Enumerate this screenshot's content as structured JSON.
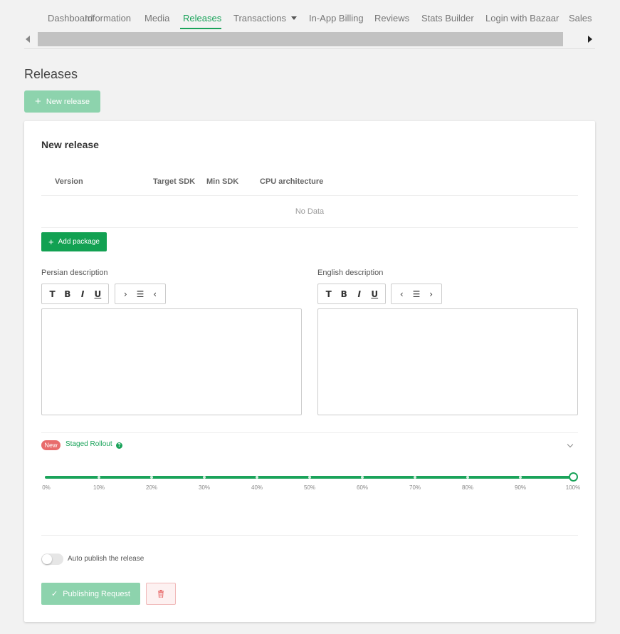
{
  "nav": {
    "tabs": [
      {
        "label": "Dashboard"
      },
      {
        "label": "Information"
      },
      {
        "label": "Media"
      },
      {
        "label": "Releases",
        "active": true
      },
      {
        "label": "Transactions"
      },
      {
        "label": "In-App Billing"
      },
      {
        "label": "Reviews"
      },
      {
        "label": "Stats Builder"
      },
      {
        "label": "Login with Bazaar"
      },
      {
        "label": "Sales Re"
      }
    ]
  },
  "page": {
    "title": "Releases",
    "new_release_label": "New release"
  },
  "card": {
    "title": "New release",
    "table": {
      "columns": [
        "Version",
        "Target SDK",
        "Min SDK",
        "CPU architecture"
      ],
      "empty_text": "No Data"
    },
    "add_package_label": "Add package",
    "persian_label": "Persian description",
    "english_label": "English description",
    "rollout": {
      "badge": "New",
      "label": "Staged Rollout",
      "help": "?",
      "ticks": [
        "0%",
        "10%",
        "20%",
        "30%",
        "40%",
        "50%",
        "60%",
        "70%",
        "80%",
        "90%",
        "100%"
      ],
      "value_percent": 100
    },
    "auto_publish_label": "Auto publish the release",
    "auto_publish_on": false,
    "publish_label": "Publishing Request"
  },
  "colors": {
    "accent": "#1aa35a",
    "accent_light": "#8dd3ad",
    "danger": "#e86c6c"
  }
}
